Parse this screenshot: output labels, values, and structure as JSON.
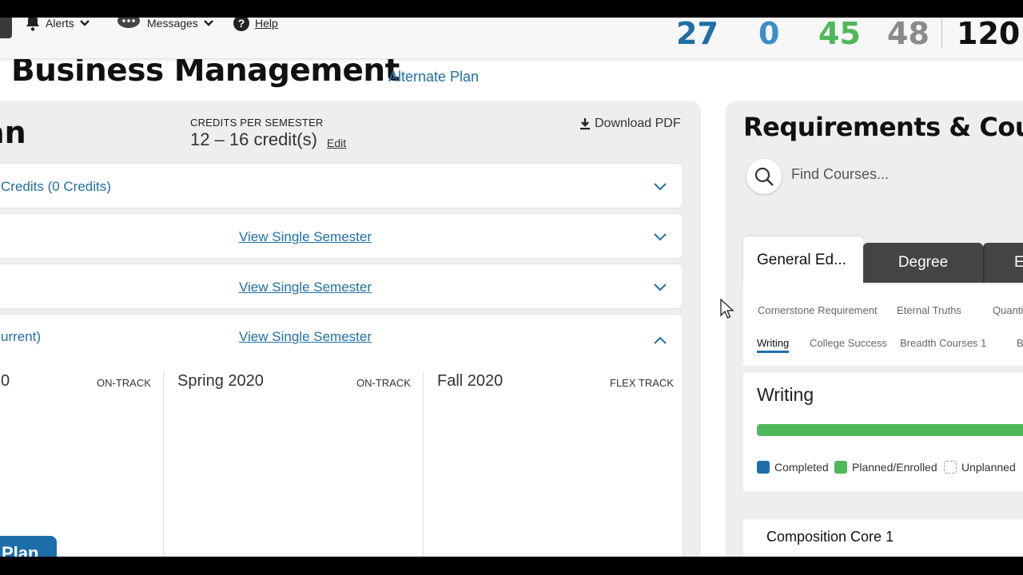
{
  "nav": {
    "alerts": "Alerts",
    "messages": "Messages",
    "help": "Help"
  },
  "stats": [
    {
      "value": "27",
      "color": "#1f6fa5"
    },
    {
      "value": "0",
      "color": "#3a8fc8"
    },
    {
      "value": "45",
      "color": "#4fb85a"
    },
    {
      "value": "48",
      "color": "#8a8a8a"
    },
    {
      "value": "120",
      "color": "#111111"
    }
  ],
  "page": {
    "title": "l Business Management",
    "alternate_plan": "Alternate Plan"
  },
  "plan": {
    "heading": "an",
    "credits_label": "CREDITS PER SEMESTER",
    "credits_value": "12 – 16 credit(s)",
    "edit": "Edit",
    "download": "Download PDF",
    "rows": [
      {
        "title": "Credits (0 Credits)",
        "link": "",
        "expanded": false
      },
      {
        "title": "",
        "link": "View Single Semester",
        "expanded": false
      },
      {
        "title": "",
        "link": "View Single Semester",
        "expanded": false
      },
      {
        "title": "urrent)",
        "link": "View Single Semester",
        "expanded": true
      }
    ],
    "semesters": [
      {
        "name": "0",
        "status": "ON-TRACK"
      },
      {
        "name": "Spring 2020",
        "status": "ON-TRACK"
      },
      {
        "name": "Fall 2020",
        "status": "FLEX TRACK"
      }
    ],
    "plan_button": "Plan"
  },
  "requirements": {
    "heading": "Requirements & Cour",
    "search_placeholder": "Find Courses...",
    "tabs": [
      "General Ed...",
      "Degree",
      "E"
    ],
    "subnav_row1": [
      "Cornerstone Requirement",
      "Eternal Truths",
      "Quantitat"
    ],
    "subnav_row2": [
      "Writing",
      "College Success",
      "Breadth Courses 1",
      "Brea"
    ],
    "section_title": "Writing",
    "progress_planned": 1.0,
    "legend": {
      "completed": "Completed",
      "planned": "Planned/Enrolled",
      "unplanned": "Unplanned"
    },
    "colors": {
      "completed": "#1c6fa8",
      "planned": "#4fb85a"
    },
    "course_group": "Composition Core 1"
  }
}
